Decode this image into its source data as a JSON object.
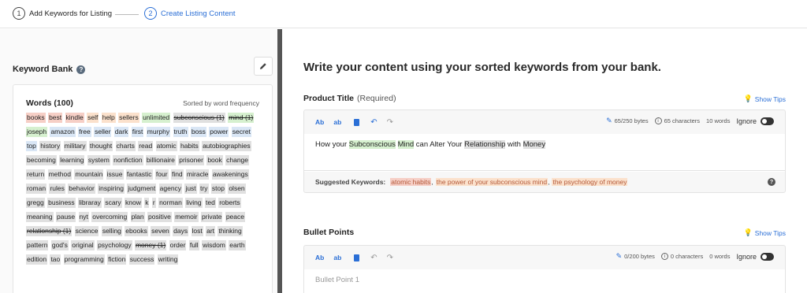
{
  "stepper": {
    "steps": [
      {
        "num": "1",
        "label": "Add Keywords for Listing"
      },
      {
        "num": "2",
        "label": "Create Listing Content"
      }
    ]
  },
  "keyword_bank": {
    "title": "Keyword Bank",
    "help": "?",
    "words_title": "Words (100)",
    "sorted_note": "Sorted by word frequency",
    "words": [
      {
        "t": "books",
        "c": "red"
      },
      {
        "t": "best",
        "c": "red"
      },
      {
        "t": "kindle",
        "c": "red"
      },
      {
        "t": "self",
        "c": "peach"
      },
      {
        "t": "help",
        "c": "peach"
      },
      {
        "t": "sellers",
        "c": "peach"
      },
      {
        "t": "unlimited",
        "c": "green"
      },
      {
        "t": "subconscious (1)",
        "c": "gray",
        "s": true
      },
      {
        "t": "mind (1)",
        "c": "green",
        "s": true
      },
      {
        "t": "joseph",
        "c": "green"
      },
      {
        "t": "amazon",
        "c": "blue"
      },
      {
        "t": "free",
        "c": "blue"
      },
      {
        "t": "seller",
        "c": "blue"
      },
      {
        "t": "dark",
        "c": "blue"
      },
      {
        "t": "first",
        "c": "blue"
      },
      {
        "t": "murphy",
        "c": "blue"
      },
      {
        "t": "truth",
        "c": "blue"
      },
      {
        "t": "boss",
        "c": "blue"
      },
      {
        "t": "power",
        "c": "blue"
      },
      {
        "t": "secret",
        "c": "blue"
      },
      {
        "t": "top",
        "c": "blue"
      },
      {
        "t": "history",
        "c": "gray"
      },
      {
        "t": "military",
        "c": "gray"
      },
      {
        "t": "thought",
        "c": "gray"
      },
      {
        "t": "charts",
        "c": "gray"
      },
      {
        "t": "read",
        "c": "gray"
      },
      {
        "t": "atomic",
        "c": "gray"
      },
      {
        "t": "habits",
        "c": "gray"
      },
      {
        "t": "autobiographies",
        "c": "gray"
      },
      {
        "t": "becoming",
        "c": "gray"
      },
      {
        "t": "learning",
        "c": "gray"
      },
      {
        "t": "system",
        "c": "gray"
      },
      {
        "t": "nonfiction",
        "c": "gray"
      },
      {
        "t": "billionaire",
        "c": "gray"
      },
      {
        "t": "prisoner",
        "c": "gray"
      },
      {
        "t": "book",
        "c": "gray"
      },
      {
        "t": "change",
        "c": "gray"
      },
      {
        "t": "return",
        "c": "gray"
      },
      {
        "t": "method",
        "c": "gray"
      },
      {
        "t": "mountain",
        "c": "gray"
      },
      {
        "t": "issue",
        "c": "gray"
      },
      {
        "t": "fantastic",
        "c": "gray"
      },
      {
        "t": "four",
        "c": "gray"
      },
      {
        "t": "find",
        "c": "gray"
      },
      {
        "t": "miracle",
        "c": "gray"
      },
      {
        "t": "awakenings",
        "c": "gray"
      },
      {
        "t": "roman",
        "c": "gray"
      },
      {
        "t": "rules",
        "c": "gray"
      },
      {
        "t": "behavior",
        "c": "gray"
      },
      {
        "t": "inspiring",
        "c": "gray"
      },
      {
        "t": "judgment",
        "c": "gray"
      },
      {
        "t": "agency",
        "c": "gray"
      },
      {
        "t": "just",
        "c": "gray"
      },
      {
        "t": "try",
        "c": "gray"
      },
      {
        "t": "stop",
        "c": "gray"
      },
      {
        "t": "olsen",
        "c": "gray"
      },
      {
        "t": "gregg",
        "c": "gray"
      },
      {
        "t": "business",
        "c": "gray"
      },
      {
        "t": "libraray",
        "c": "gray"
      },
      {
        "t": "scary",
        "c": "gray"
      },
      {
        "t": "know",
        "c": "gray"
      },
      {
        "t": "k",
        "c": "gray"
      },
      {
        "t": "r",
        "c": "gray"
      },
      {
        "t": "norman",
        "c": "gray"
      },
      {
        "t": "living",
        "c": "gray"
      },
      {
        "t": "ted",
        "c": "gray"
      },
      {
        "t": "roberts",
        "c": "gray"
      },
      {
        "t": "meaning",
        "c": "gray"
      },
      {
        "t": "pause",
        "c": "gray"
      },
      {
        "t": "nyt",
        "c": "gray"
      },
      {
        "t": "overcoming",
        "c": "gray"
      },
      {
        "t": "plan",
        "c": "gray"
      },
      {
        "t": "positive",
        "c": "gray"
      },
      {
        "t": "memoir",
        "c": "gray"
      },
      {
        "t": "private",
        "c": "gray"
      },
      {
        "t": "peace",
        "c": "gray"
      },
      {
        "t": "relationship (1)",
        "c": "gray",
        "s": true
      },
      {
        "t": "science",
        "c": "gray"
      },
      {
        "t": "selling",
        "c": "gray"
      },
      {
        "t": "ebooks",
        "c": "gray"
      },
      {
        "t": "seven",
        "c": "gray"
      },
      {
        "t": "days",
        "c": "gray"
      },
      {
        "t": "lost",
        "c": "gray"
      },
      {
        "t": "art",
        "c": "gray"
      },
      {
        "t": "thinking",
        "c": "gray"
      },
      {
        "t": "pattern",
        "c": "gray"
      },
      {
        "t": "god's",
        "c": "gray"
      },
      {
        "t": "original",
        "c": "gray"
      },
      {
        "t": "psychology",
        "c": "gray"
      },
      {
        "t": "money (1)",
        "c": "gray",
        "s": true
      },
      {
        "t": "order",
        "c": "gray"
      },
      {
        "t": "full",
        "c": "gray"
      },
      {
        "t": "wisdom",
        "c": "gray"
      },
      {
        "t": "earth",
        "c": "gray"
      },
      {
        "t": "edition",
        "c": "gray"
      },
      {
        "t": "tao",
        "c": "gray"
      },
      {
        "t": "programming",
        "c": "gray"
      },
      {
        "t": "fiction",
        "c": "gray"
      },
      {
        "t": "success",
        "c": "gray"
      },
      {
        "t": "writing",
        "c": "gray"
      }
    ]
  },
  "main": {
    "heading": "Write your content using your sorted keywords from your bank.",
    "show_tips": "Show Tips",
    "toolbar": {
      "ab1": "Ab",
      "ab2": "ab"
    },
    "ignore_label": "Ignore",
    "product_title": {
      "label": "Product Title",
      "required": "(Required)",
      "bytes": "65/250 bytes",
      "characters": "65 characters",
      "words": "10 words",
      "text_parts": [
        {
          "t": "How your ",
          "h": ""
        },
        {
          "t": "Subconscious",
          "h": "green"
        },
        {
          "t": " ",
          "h": ""
        },
        {
          "t": "Mind",
          "h": "green"
        },
        {
          "t": " can Alter Your ",
          "h": ""
        },
        {
          "t": "Relationship",
          "h": "gray"
        },
        {
          "t": " with ",
          "h": ""
        },
        {
          "t": "Money",
          "h": "gray"
        }
      ],
      "suggested_label": "Suggested Keywords:",
      "suggested": [
        {
          "t": "atomic habits",
          "c": "red"
        },
        {
          "t": "the power of your subconscious mind",
          "c": "peach"
        },
        {
          "t": "the psychology of money",
          "c": "peach"
        }
      ]
    },
    "bullet_points": {
      "label": "Bullet Points",
      "bytes": "0/200 bytes",
      "characters": "0 characters",
      "words": "0 words",
      "placeholder": "Bullet Point 1"
    }
  }
}
